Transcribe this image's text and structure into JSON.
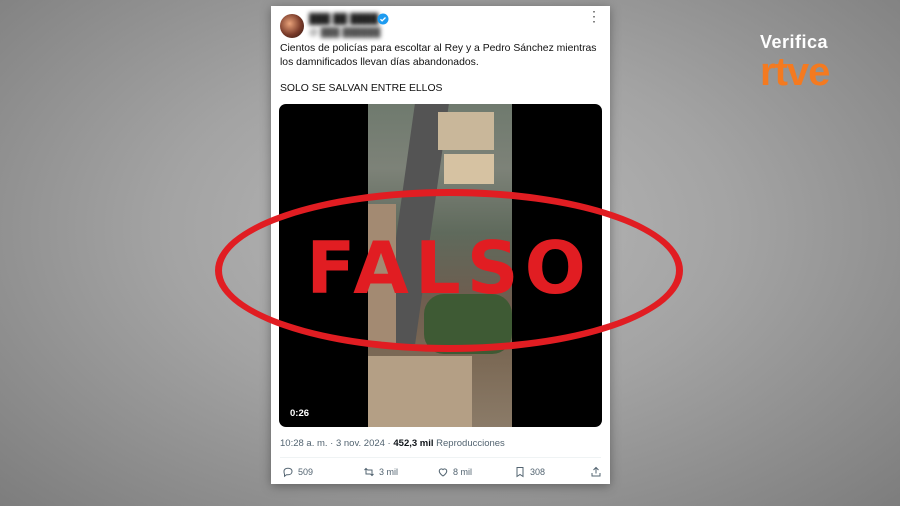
{
  "tweet": {
    "author_name_blurred": "███ ██ ████",
    "author_handle_blurred": "@ ███ ██████",
    "text_line1": "Cientos de policías para escoltar al Rey y a Pedro Sánchez mientras los damnificados llevan días abandonados.",
    "text_line2": "SOLO SE SALVAN ENTRE ELLOS",
    "video_duration": "0:26",
    "timestamp": "10:28 a. m. · 3 nov. 2024 ·",
    "views_count": "452,3 mil",
    "views_label": "Reproducciones",
    "replies": "509",
    "retweets": "3 mil",
    "likes": "8 mil",
    "bookmarks": "308"
  },
  "overlay": {
    "verdict": "FALSO",
    "verdict_color": "#e11d22"
  },
  "brand": {
    "top": "Verifica",
    "bottom": "rtve",
    "color": "#f47a20"
  }
}
